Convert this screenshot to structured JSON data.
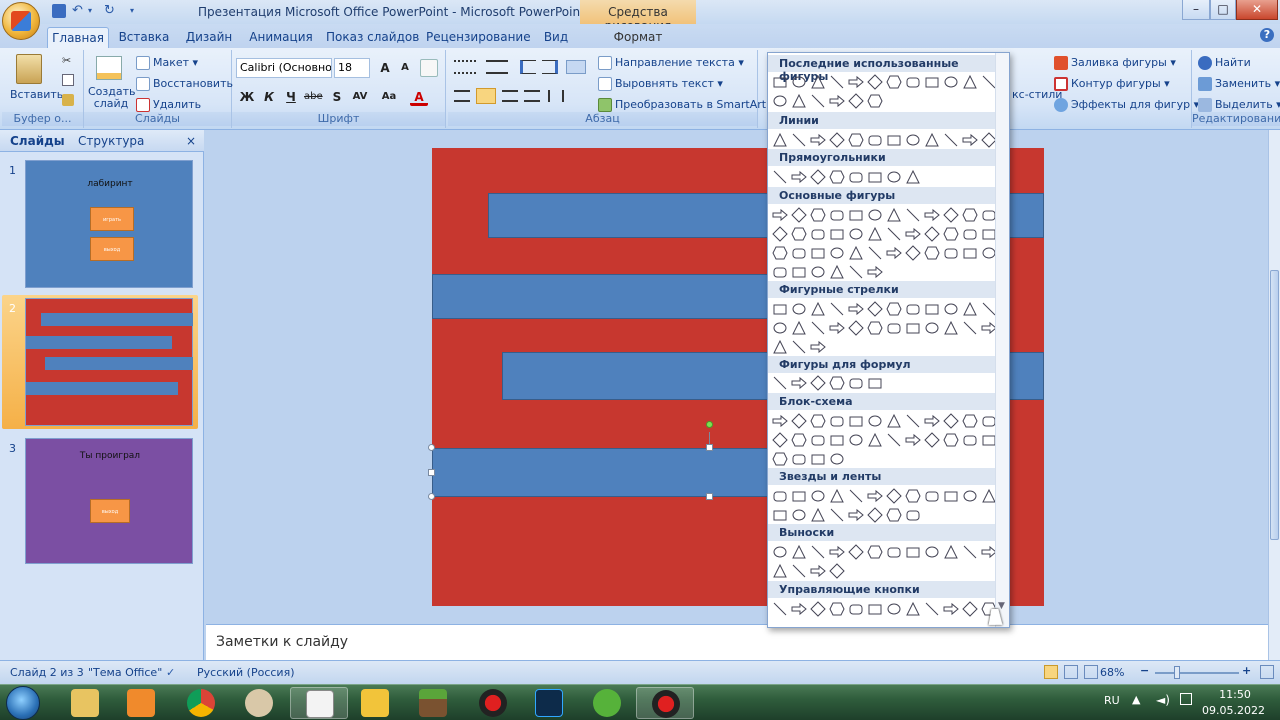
{
  "window": {
    "title": "Презентация Microsoft Office PowerPoint - Microsoft PowerPoint",
    "context_title": "Средства рисования",
    "minimize": "–",
    "maximize": "□",
    "close": "✕"
  },
  "tabs": [
    "Главная",
    "Вставка",
    "Дизайн",
    "Анимация",
    "Показ слайдов",
    "Рецензирование",
    "Вид"
  ],
  "context_tab": "Формат",
  "ribbon": {
    "clipboard": {
      "paste": "Вставить",
      "label": "Буфер о..."
    },
    "slides": {
      "new_slide": "Создать слайд",
      "layout": "Макет",
      "reset": "Восстановить",
      "delete": "Удалить",
      "label": "Слайды"
    },
    "font": {
      "font_name": "Calibri (Основно",
      "font_size": "18",
      "label": "Шрифт",
      "bold": "Ж",
      "italic": "К",
      "underline": "Ч",
      "strike": "abe",
      "shadow": "S",
      "spacing": "AV",
      "case": "Aa",
      "color": "A",
      "grow": "A",
      "shrink": "A"
    },
    "paragraph": {
      "text_direction": "Направление текста",
      "align_text": "Выровнять текст",
      "smartart": "Преобразовать в SmartArt",
      "label": "Абзац"
    },
    "drawing": {
      "styles_partial": "кс-стили",
      "fill": "Заливка фигуры",
      "outline": "Контур фигуры",
      "effects": "Эффекты для фигур"
    },
    "editing": {
      "find": "Найти",
      "replace": "Заменить",
      "select": "Выделить",
      "label": "Редактирование"
    }
  },
  "panel": {
    "tab_slides": "Слайды",
    "tab_outline": "Структура",
    "close": "×",
    "slides": [
      {
        "num": "1",
        "title": "лабиринт",
        "btn1": "играть",
        "btn2": "выход"
      },
      {
        "num": "2"
      },
      {
        "num": "3",
        "title": "Ты проиграл",
        "btn1": "выход"
      }
    ]
  },
  "shapes_menu": {
    "sections": [
      "Последние использованные фигуры",
      "Линии",
      "Прямоугольники",
      "Основные фигуры",
      "Фигурные стрелки",
      "Фигуры для формул",
      "Блок-схема",
      "Звезды и ленты",
      "Выноски",
      "Управляющие кнопки"
    ]
  },
  "notes_placeholder": "Заметки к слайду",
  "status": {
    "slide_info": "Слайд 2 из 3",
    "theme": "\"Тема Office\"",
    "language": "Русский (Россия)",
    "zoom": "68%"
  },
  "taskbar": {
    "lang": "RU",
    "time": "11:50",
    "date": "09.05.2022"
  },
  "colors": {
    "slide_red": "#c7372f",
    "bar_blue": "#4f81bd",
    "thumb_purple": "#7b4fa3",
    "thumb_blue": "#4f81bd",
    "orange_button": "#f79646"
  }
}
